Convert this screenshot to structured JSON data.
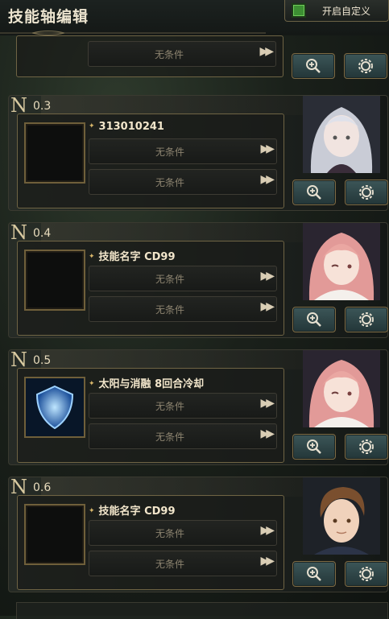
{
  "header": {
    "title": "技能轴编辑",
    "custom_toggle": {
      "label": "开启自定义",
      "checked": true
    }
  },
  "cards": [
    {
      "no": "3",
      "skill_name": "313010241",
      "conditions": [
        "无条件",
        "无条件"
      ],
      "has_icon": false,
      "portrait": "silver-haired-girl"
    },
    {
      "no": "4",
      "skill_name": "技能名字 CD99",
      "conditions": [
        "无条件",
        "无条件"
      ],
      "has_icon": false,
      "portrait": "pink-haired-girl"
    },
    {
      "no": "5",
      "skill_name": "太阳与消融 8回合冷却",
      "conditions": [
        "无条件",
        "无条件"
      ],
      "has_icon": true,
      "portrait": "pink-haired-girl-winking"
    },
    {
      "no": "6",
      "skill_name": "技能名字 CD99",
      "conditions": [
        "无条件",
        "无条件"
      ],
      "has_icon": false,
      "portrait": "brown-haired-man"
    }
  ],
  "partial_card": {
    "conditions": [
      "无条件"
    ]
  },
  "colors": {
    "accent_gold": "#6f6444",
    "button_teal": "#3c5658",
    "toggle_green": "#3d8f33"
  }
}
